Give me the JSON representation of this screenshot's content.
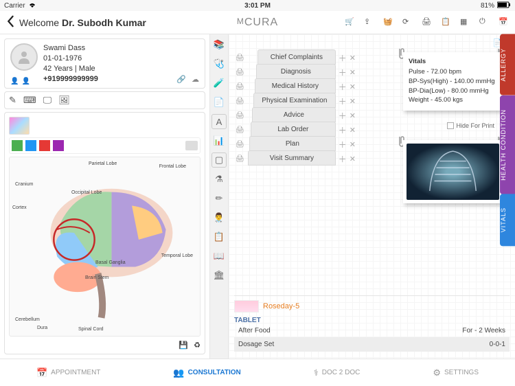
{
  "status": {
    "carrier": "Carrier",
    "time": "3:01 PM",
    "battery": "81%"
  },
  "header": {
    "welcome_prefix": "Welcome",
    "doctor_name": "Dr. Subodh Kumar",
    "logo": "CURA",
    "logo_prefix": "M"
  },
  "patient": {
    "name": "Swami Dass",
    "dob": "01-01-1976",
    "age_gender": "42 Years | Male",
    "phone": "+919999999999"
  },
  "palette": [
    "#4caf50",
    "#2196f3",
    "#e53935",
    "#9c27b0"
  ],
  "sections": [
    "Chief Complaints",
    "Diagnosis",
    "Medical History",
    "Physical Examination",
    "Advice",
    "Lab Order",
    "Plan",
    "Visit Summary"
  ],
  "vitals": {
    "title": "Vitals",
    "pulse": "Pulse - 72.00 bpm",
    "bp_sys": "BP-Sys(High) - 140.00 mmHg",
    "bp_dia": "BP-Dia(Low) - 80.00 mmHg",
    "weight": "Weight - 45.00 kgs"
  },
  "hide_for_print": "Hide For Print",
  "rx": {
    "name": "Roseday-5",
    "type": "TABLET",
    "timing": "After Food",
    "duration": "For - 2 Weeks",
    "dosage_label": "Dosage Set",
    "dosage_value": "0-0-1"
  },
  "side_tabs": {
    "allergy": "ALLERGY",
    "health": "HEALTH CONDITION",
    "vitals": "VITALS"
  },
  "bottom_nav": {
    "appointment": "APPOINTMENT",
    "consultation": "CONSULTATION",
    "doc2doc": "DOC 2 DOC",
    "settings": "SETTINGS"
  },
  "brain_labels": {
    "parietal": "Parietal Lobe",
    "frontal": "Frontal Lobe",
    "cranium": "Cranium",
    "cortex": "Cortex",
    "occipital": "Occipital Lobe",
    "temporal": "Temporal Lobe",
    "basal": "Basal Ganglia",
    "brainstem": "Brain Stem",
    "cerebellum": "Cerebellum",
    "dura": "Dura",
    "spinal": "Spinal Cord"
  }
}
